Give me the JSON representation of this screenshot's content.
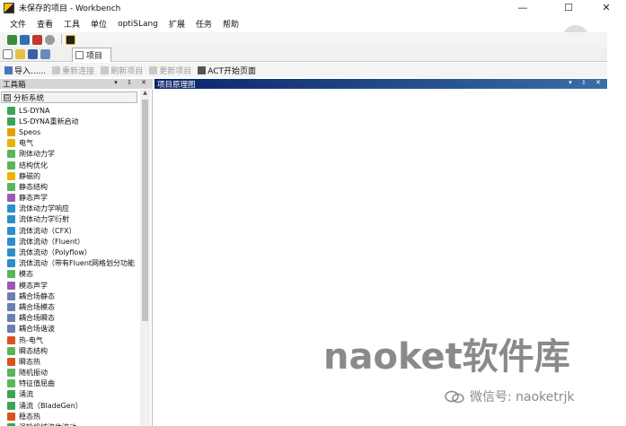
{
  "window": {
    "title": "未保存的项目 - Workbench",
    "minimize": "—",
    "maximize": "☐",
    "close": "✕"
  },
  "menu": [
    "文件",
    "查看",
    "工具",
    "单位",
    "optiSLang",
    "扩展",
    "任务",
    "帮助"
  ],
  "tab": {
    "label": "项目"
  },
  "toolbar3": {
    "import": "导入......",
    "reconnect": "重新连接",
    "refresh": "刷新项目",
    "update": "更新项目",
    "act_start": "ACT开始页面"
  },
  "toolbox": {
    "title": "工具箱",
    "controls": "▾ ⇩ ✕",
    "group": {
      "toggle": "⊟",
      "label": "分析系统"
    },
    "items": [
      {
        "label": "LS-DYNA",
        "color": "#3aa655"
      },
      {
        "label": "LS-DYNA重新启动",
        "color": "#3aa655"
      },
      {
        "label": "Speos",
        "color": "#e8a000"
      },
      {
        "label": "电气",
        "color": "#e8b400"
      },
      {
        "label": "刚体动力学",
        "color": "#5ab55a"
      },
      {
        "label": "结构优化",
        "color": "#5ab55a"
      },
      {
        "label": "静磁的",
        "color": "#e8b400"
      },
      {
        "label": "静态结构",
        "color": "#5ab55a"
      },
      {
        "label": "静态声学",
        "color": "#9b59b6"
      },
      {
        "label": "流体动力学响应",
        "color": "#2a8fc9"
      },
      {
        "label": "流体动力学衍射",
        "color": "#2a8fc9"
      },
      {
        "label": "流体流动（CFX）",
        "color": "#2a8fc9"
      },
      {
        "label": "流体流动（Fluent）",
        "color": "#2a8fc9"
      },
      {
        "label": "流体流动（Polyflow）",
        "color": "#2a8fc9"
      },
      {
        "label": "流体流动（带有Fluent网格划分功能",
        "color": "#2a8fc9"
      },
      {
        "label": "模态",
        "color": "#5ab55a"
      },
      {
        "label": "模态声学",
        "color": "#9b59b6"
      },
      {
        "label": "耦合场静态",
        "color": "#6a7fb0"
      },
      {
        "label": "耦合场模态",
        "color": "#6a7fb0"
      },
      {
        "label": "耦合场瞬态",
        "color": "#6a7fb0"
      },
      {
        "label": "耦合场谐波",
        "color": "#6a7fb0"
      },
      {
        "label": "热-电气",
        "color": "#d9531e"
      },
      {
        "label": "瞬态结构",
        "color": "#5ab55a"
      },
      {
        "label": "瞬态热",
        "color": "#d9531e"
      },
      {
        "label": "随机振动",
        "color": "#5ab55a"
      },
      {
        "label": "特征值屈曲",
        "color": "#5ab55a"
      },
      {
        "label": "涌流",
        "color": "#3aa655"
      },
      {
        "label": "涌流（BladeGen）",
        "color": "#3aa655"
      },
      {
        "label": "稳态热",
        "color": "#d9531e"
      },
      {
        "label": "涡轮机械流体流动",
        "color": "#3aa655"
      }
    ]
  },
  "schematic": {
    "title": "项目原理图",
    "controls": "▾ ⇩ ✕"
  },
  "watermark": {
    "main": "naoket软件库",
    "sub": "微信号: naoketrjk"
  }
}
